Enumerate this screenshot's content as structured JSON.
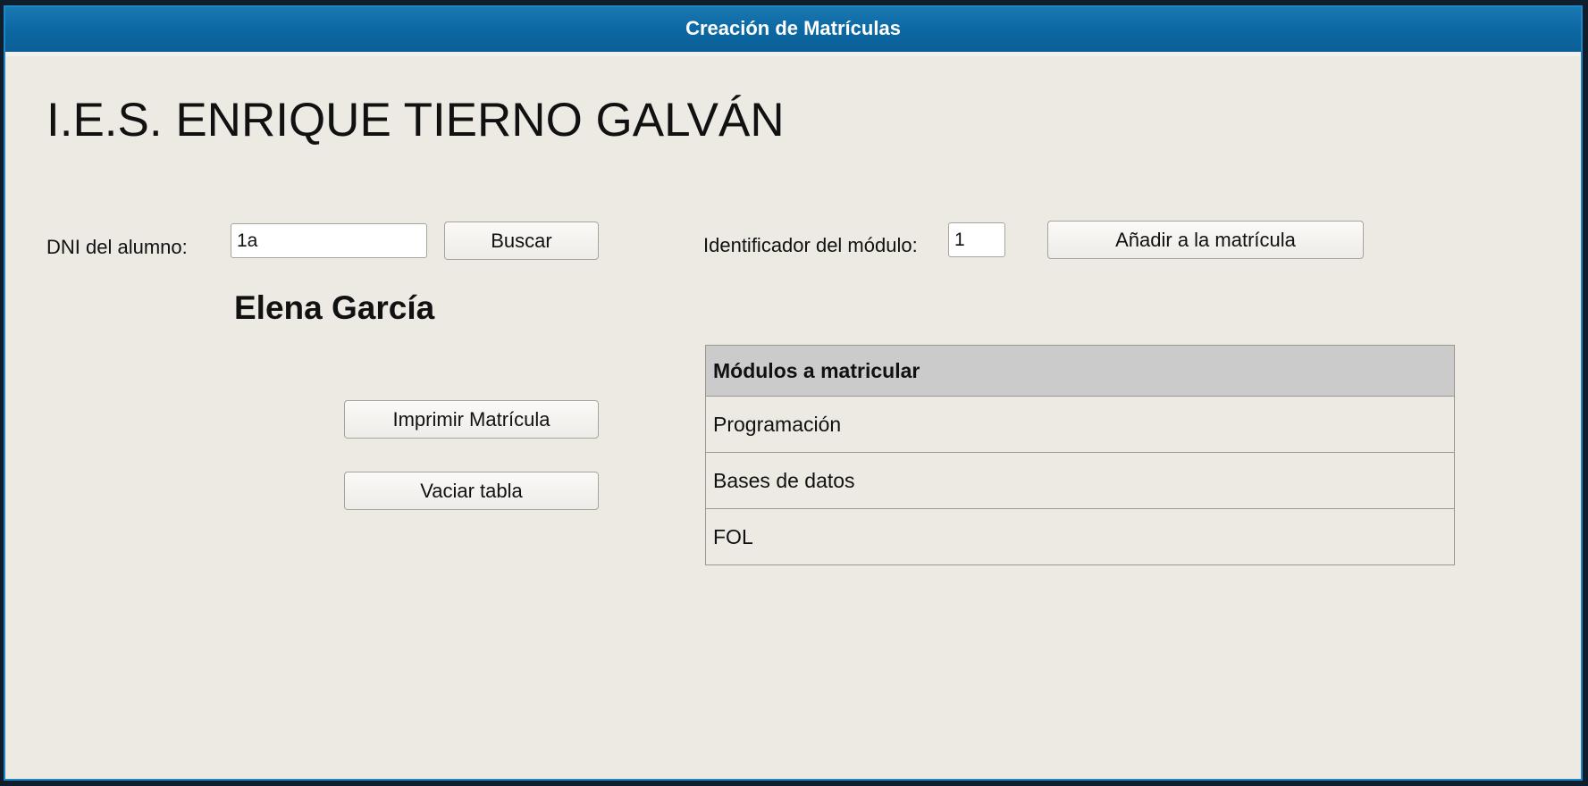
{
  "window": {
    "title": "Creación de Matrículas"
  },
  "header": {
    "school_name": "I.E.S. ENRIQUE TIERNO GALVÁN"
  },
  "student_search": {
    "dni_label": "DNI del alumno:",
    "dni_value": "1a",
    "search_button": "Buscar",
    "student_name": "Elena García"
  },
  "module_entry": {
    "module_id_label": "Identificador del módulo:",
    "module_id_value": "1",
    "add_button": "Añadir a la matrícula"
  },
  "actions": {
    "print_button": "Imprimir Matrícula",
    "clear_button": "Vaciar tabla"
  },
  "modules_table": {
    "header": "Módulos a matricular",
    "rows": [
      "Programación",
      "Bases de datos",
      "FOL"
    ]
  }
}
